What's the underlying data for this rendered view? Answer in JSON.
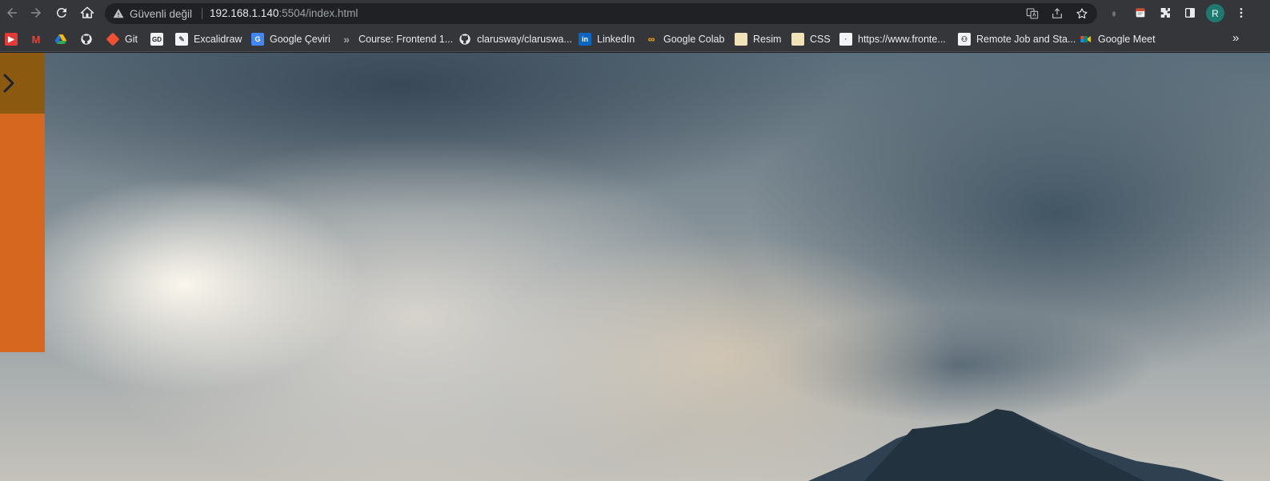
{
  "browser": {
    "nav": {
      "back_icon": "back-arrow-icon",
      "forward_icon": "forward-arrow-icon",
      "reload_icon": "reload-icon",
      "home_icon": "home-icon"
    },
    "omnibox": {
      "security_label": "Güvenli değil",
      "security_icon": "warning-icon",
      "url_host": "192.168.1.140",
      "url_rest": ":5504/index.html"
    },
    "profile_initial": "R",
    "accent_colors": {
      "toolbar": "#35363a",
      "omnibox": "#202124",
      "avatar": "#1e7a6e"
    }
  },
  "bookmarks": [
    {
      "label": "",
      "icon": "youtube-icon"
    },
    {
      "label": "",
      "icon": "gmail-icon"
    },
    {
      "label": "",
      "icon": "google-drive-icon"
    },
    {
      "label": "",
      "icon": "github-icon"
    },
    {
      "label": "Git",
      "icon": "git-icon"
    },
    {
      "label": "",
      "icon": "codepen-icon"
    },
    {
      "label": "Excalidraw",
      "icon": "excalidraw-icon"
    },
    {
      "label": "Google Çeviri",
      "icon": "google-translate-icon"
    },
    {
      "label": "Course: Frontend 1...",
      "icon": "course-icon"
    },
    {
      "label": "clarusway/claruswa...",
      "icon": "github-icon"
    },
    {
      "label": "LinkedIn",
      "icon": "linkedin-icon"
    },
    {
      "label": "Google Colab",
      "icon": "colab-icon"
    },
    {
      "label": "Resim",
      "icon": "folder-icon"
    },
    {
      "label": "CSS",
      "icon": "folder-icon"
    },
    {
      "label": "https://www.fronte...",
      "icon": "page-icon"
    },
    {
      "label": "Remote Job and Sta...",
      "icon": "remote-icon"
    },
    {
      "label": "Google Meet",
      "icon": "google-meet-icon"
    }
  ],
  "page": {
    "side_panel_color": "#d5681e",
    "side_toggle_color": "#8b5a10",
    "toggle_icon": "chevron-right-icon"
  }
}
